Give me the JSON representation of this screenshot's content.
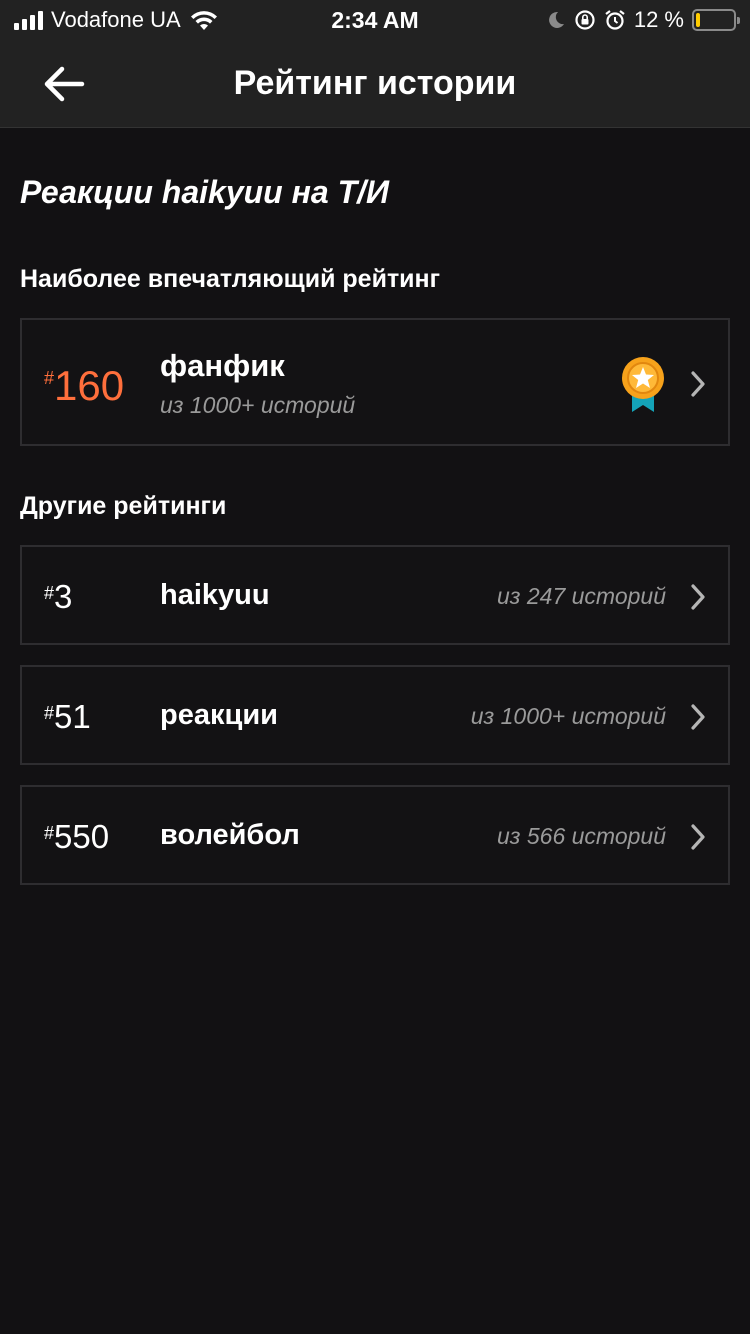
{
  "status_bar": {
    "carrier": "Vodafone UA",
    "time": "2:34 AM",
    "battery_percent": "12 %",
    "battery_level": 0.12
  },
  "nav": {
    "title": "Рейтинг истории"
  },
  "story": {
    "title": "Реакции haikyuu на Т/И"
  },
  "sections": {
    "best": "Наиболее впечатляющий рейтинг",
    "other": "Другие рейтинги"
  },
  "best_ranking": {
    "hash": "#",
    "rank": "160",
    "tag": "фанфик",
    "out_of": "из 1000+ историй"
  },
  "other_rankings": [
    {
      "hash": "#",
      "rank": "3",
      "tag": "haikyuu",
      "out_of": "из 247 историй"
    },
    {
      "hash": "#",
      "rank": "51",
      "tag": "реакции",
      "out_of": "из 1000+ историй"
    },
    {
      "hash": "#",
      "rank": "550",
      "tag": "волейбол",
      "out_of": "из 566 историй"
    }
  ],
  "colors": {
    "accent_orange": "#ff6f3c",
    "medal_gold": "#f7a21b",
    "medal_ribbon": "#14a3b8",
    "background": "#121113",
    "card_border": "#2e2d30"
  },
  "icons": [
    "signal-icon",
    "wifi-icon",
    "moon-icon",
    "rotation-lock-icon",
    "alarm-icon",
    "battery-icon",
    "back-arrow-icon",
    "medal-icon",
    "chevron-right-icon"
  ]
}
